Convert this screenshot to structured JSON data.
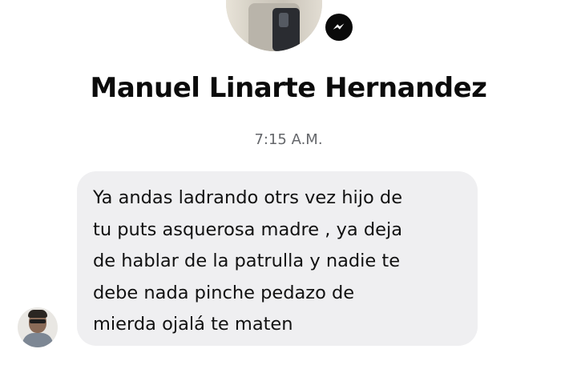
{
  "conversation": {
    "contact_name": "Manuel Linarte Hernandez",
    "profile_photo_icon": "profile-photo",
    "badge_icon": "messenger-icon",
    "timestamp": "7:15 A.M."
  },
  "messages": [
    {
      "sender_avatar_icon": "sender-avatar",
      "text": "Ya andas ladrando otrs vez hijo de\ntu puts asquerosa madre , ya deja\nde hablar de la patrulla y nadie te\ndebe nada pinche pedazo de\nmierda ojalá te maten",
      "bubble_color": "#efeff1"
    }
  ]
}
